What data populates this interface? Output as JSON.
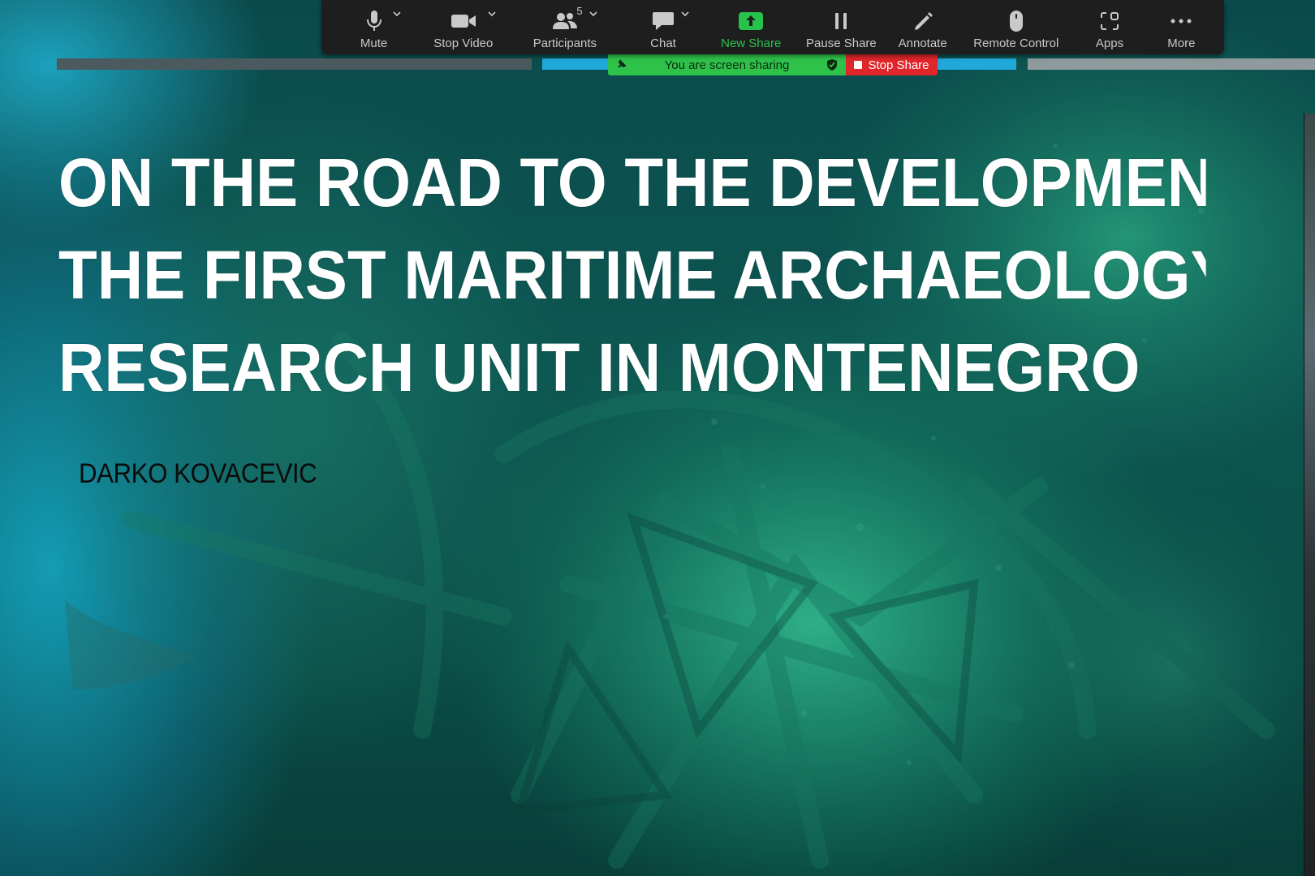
{
  "toolbar": {
    "mute": "Mute",
    "stop_video": "Stop Video",
    "participants": "Participants",
    "participants_count": "5",
    "chat": "Chat",
    "new_share": "New Share",
    "pause_share": "Pause Share",
    "annotate": "Annotate",
    "remote_control": "Remote Control",
    "apps": "Apps",
    "more": "More"
  },
  "sharing": {
    "status": "You are screen sharing",
    "stop_label": "Stop Share"
  },
  "slide": {
    "title_lines": [
      "ON THE ROAD TO THE DEVELOPMENT",
      "THE FIRST MARITIME ARCHAEOLOGY",
      "RESEARCH UNIT IN MONTENEGRO"
    ],
    "author": "DARKO KOVACEVIC"
  },
  "colors": {
    "toolbar_bg": "#1e1e1e",
    "sharing_green": "#2fc24a",
    "stop_red": "#e0262b",
    "title_white": "#ffffff"
  }
}
